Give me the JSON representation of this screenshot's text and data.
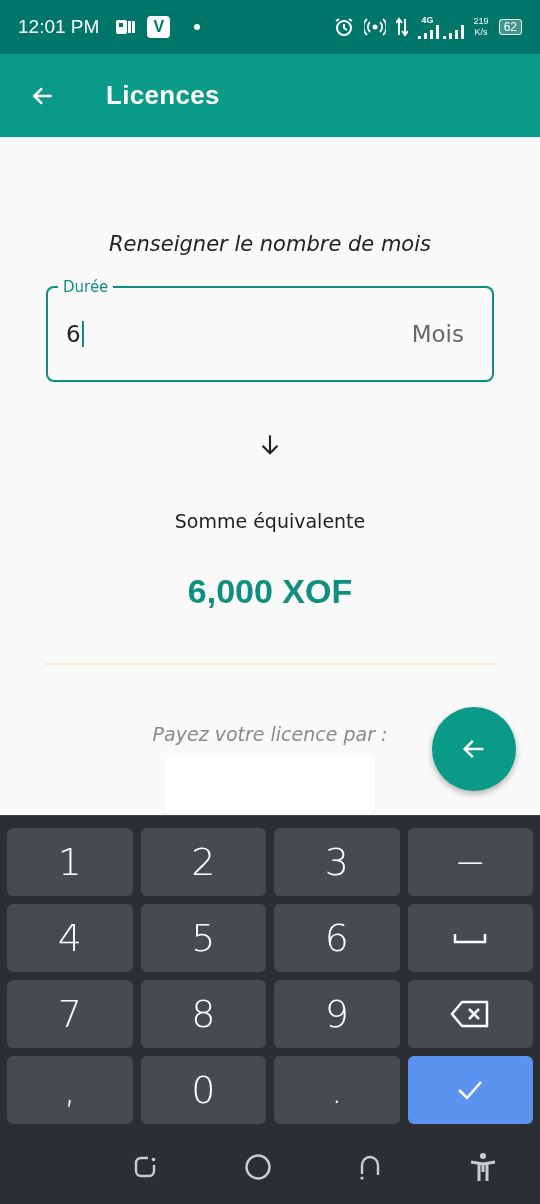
{
  "status_bar": {
    "time": "12:01 PM",
    "app_badge": "V",
    "network": "4G",
    "speed_value": "219",
    "speed_unit": "K/s",
    "battery": "62"
  },
  "app_bar": {
    "title": "Licences"
  },
  "form": {
    "prompt": "Renseigner le nombre de mois",
    "field": {
      "label": "Durée",
      "value": "6",
      "suffix": "Mois",
      "focused": true
    }
  },
  "result": {
    "label": "Somme équivalente",
    "amount": "6,000 XOF"
  },
  "payment": {
    "prompt": "Payez votre licence par :"
  },
  "keyboard": {
    "rows": [
      [
        {
          "kind": "text",
          "label": "1"
        },
        {
          "kind": "text",
          "label": "2"
        },
        {
          "kind": "text",
          "label": "3"
        },
        {
          "kind": "text",
          "label": "−"
        }
      ],
      [
        {
          "kind": "text",
          "label": "4"
        },
        {
          "kind": "text",
          "label": "5"
        },
        {
          "kind": "text",
          "label": "6"
        },
        {
          "kind": "space"
        }
      ],
      [
        {
          "kind": "text",
          "label": "7"
        },
        {
          "kind": "text",
          "label": "8"
        },
        {
          "kind": "text",
          "label": "9"
        },
        {
          "kind": "backspace"
        }
      ],
      [
        {
          "kind": "text",
          "label": ","
        },
        {
          "kind": "text",
          "label": "0"
        },
        {
          "kind": "text",
          "label": "."
        },
        {
          "kind": "done"
        }
      ]
    ]
  }
}
